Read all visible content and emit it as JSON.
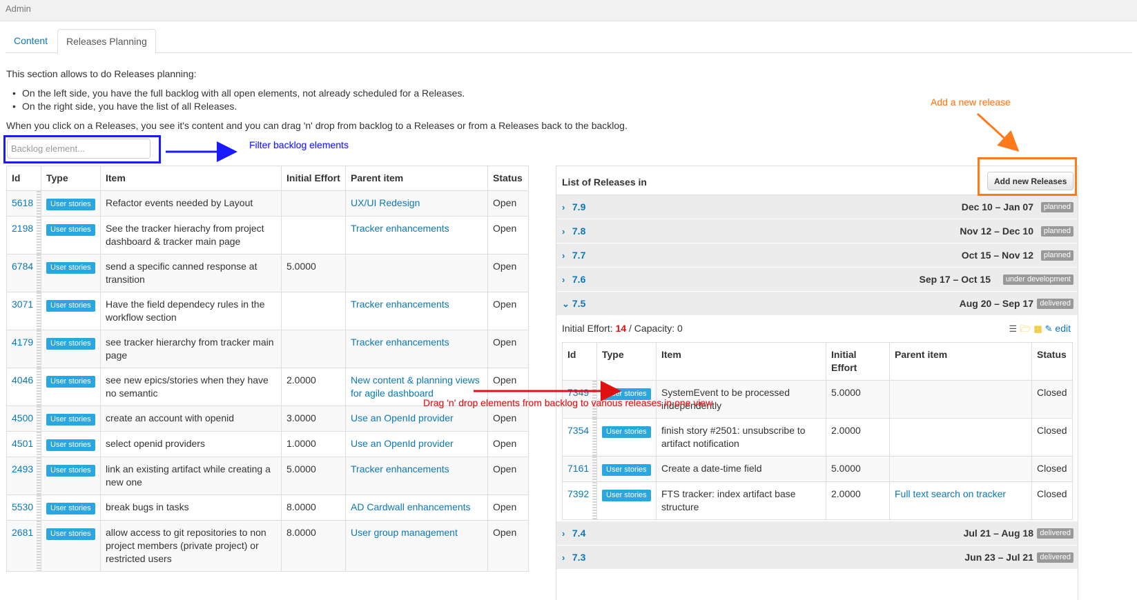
{
  "topbar": {
    "title": "Admin"
  },
  "tabs": [
    {
      "label": "Content"
    },
    {
      "label": "Releases Planning"
    }
  ],
  "intro": {
    "line1": "This section allows to do Releases planning:",
    "bullets": [
      "On the left side, you have the full backlog with all open elements, not already scheduled for a Releases.",
      "On the right side, you have the list of all Releases."
    ],
    "line2": "When you click on a Releases, you see it's content and you can drag 'n' drop from backlog to a Releases or from a Releases back to the backlog."
  },
  "filter": {
    "placeholder": "Backlog element..."
  },
  "annotations": {
    "filter": "Filter backlog elements",
    "add": "Add a new release",
    "drag": "Drag 'n' drop elements from backlog to various releases in one view"
  },
  "backlog": {
    "headers": [
      "Id",
      "Type",
      "Item",
      "Initial Effort",
      "Parent item",
      "Status"
    ],
    "rows": [
      {
        "id": "5618",
        "type": "User stories",
        "item": "Refactor events needed by Layout",
        "effort": "",
        "parent": "UX/UI Redesign",
        "status": "Open"
      },
      {
        "id": "2198",
        "type": "User stories",
        "item": "See the tracker hierachy from project dashboard & tracker main page",
        "effort": "",
        "parent": "Tracker enhancements",
        "status": "Open"
      },
      {
        "id": "6784",
        "type": "User stories",
        "item": "send a specific canned response at transition",
        "effort": "5.0000",
        "parent": "",
        "status": "Open"
      },
      {
        "id": "3071",
        "type": "User stories",
        "item": "Have the field dependecy rules in the workflow section",
        "effort": "",
        "parent": "Tracker enhancements",
        "status": "Open"
      },
      {
        "id": "4179",
        "type": "User stories",
        "item": "see tracker hierarchy from tracker main page",
        "effort": "",
        "parent": "Tracker enhancements",
        "status": "Open"
      },
      {
        "id": "4046",
        "type": "User stories",
        "item": "see new epics/stories when they have no semantic",
        "effort": "2.0000",
        "parent": "New content & planning views for agile dashboard",
        "status": "Open"
      },
      {
        "id": "4500",
        "type": "User stories",
        "item": "create an account with openid",
        "effort": "3.0000",
        "parent": "Use an OpenId provider",
        "status": "Open"
      },
      {
        "id": "4501",
        "type": "User stories",
        "item": "select openid providers",
        "effort": "1.0000",
        "parent": "Use an OpenId provider",
        "status": "Open"
      },
      {
        "id": "2493",
        "type": "User stories",
        "item": "link an existing artifact while creating a new one",
        "effort": "5.0000",
        "parent": "Tracker enhancements",
        "status": "Open"
      },
      {
        "id": "5530",
        "type": "User stories",
        "item": "break bugs in tasks",
        "effort": "8.0000",
        "parent": "AD Cardwall enhancements",
        "status": "Open"
      },
      {
        "id": "2681",
        "type": "User stories",
        "item": "allow access to git repositories to non project members (private project) or restricted users",
        "effort": "8.0000",
        "parent": "User group management",
        "status": "Open"
      }
    ]
  },
  "releases": {
    "title": "List of Releases in",
    "add_button": "Add new Releases",
    "items_top": [
      {
        "name": "7.9",
        "dates": "Dec 10 – Jan 07",
        "status": "planned"
      },
      {
        "name": "7.8",
        "dates": "Nov 12 – Dec 10",
        "status": "planned"
      },
      {
        "name": "7.7",
        "dates": "Oct 15 – Nov 12",
        "status": "planned"
      },
      {
        "name": "7.6",
        "dates": "Sep 17 – Oct 15",
        "status": "under development"
      }
    ],
    "expanded": {
      "name": "7.5",
      "dates": "Aug 20 – Sep 17",
      "status": "delivered",
      "effort_label": "Initial Effort: ",
      "effort_value": "14",
      "capacity": " / Capacity: 0",
      "edit_label": "edit",
      "headers": [
        "Id",
        "Type",
        "Item",
        "Initial Effort",
        "Parent item",
        "Status"
      ],
      "rows": [
        {
          "id": "7349",
          "type": "User stories",
          "item": "SystemEvent to be processed independently",
          "effort": "5.0000",
          "parent": "",
          "status": "Closed"
        },
        {
          "id": "7354",
          "type": "User stories",
          "item": "finish story #2501: unsubscribe to artifact notification",
          "effort": "2.0000",
          "parent": "",
          "status": "Closed"
        },
        {
          "id": "7161",
          "type": "User stories",
          "item": "Create a date-time field",
          "effort": "5.0000",
          "parent": "",
          "status": "Closed"
        },
        {
          "id": "7392",
          "type": "User stories",
          "item": "FTS tracker: index artifact base structure",
          "effort": "2.0000",
          "parent": "Full text search on tracker",
          "status": "Closed"
        }
      ]
    },
    "items_bottom": [
      {
        "name": "7.4",
        "dates": "Jul 21 – Aug 18",
        "status": "delivered"
      },
      {
        "name": "7.3",
        "dates": "Jun 23 – Jul 21",
        "status": "delivered"
      }
    ]
  },
  "colors": {
    "link": "#0a78b8",
    "type_badge": "#2aa7e0",
    "status_badge": "#999999",
    "annotation_blue": "#1a1aff",
    "annotation_orange": "#ff7a1a",
    "annotation_red": "#e01010"
  },
  "icons": [
    "chevron-right-icon",
    "chevron-down-icon",
    "list-icon",
    "add-folder-icon",
    "folder-icon",
    "edit-icon"
  ]
}
